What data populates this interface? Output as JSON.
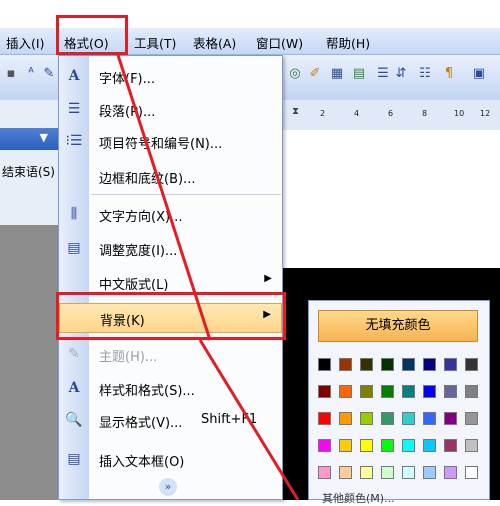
{
  "menubar": {
    "items": [
      {
        "label": "插入(I)"
      },
      {
        "label": "格式(O)"
      },
      {
        "label": "工具(T)"
      },
      {
        "label": "表格(A)"
      },
      {
        "label": "窗口(W)"
      },
      {
        "label": "帮助(H)"
      }
    ]
  },
  "ruler": {
    "ticks": [
      "2",
      "2",
      "4",
      "6",
      "8",
      "10",
      "12",
      "14"
    ]
  },
  "left_pane": {
    "label": "结束语(S)"
  },
  "format_menu": {
    "items": [
      {
        "label": "字体(F)...",
        "icon": "font-icon"
      },
      {
        "label": "段落(P)...",
        "icon": "paragraph-icon"
      },
      {
        "label": "项目符号和编号(N)...",
        "icon": "bullets-icon"
      },
      {
        "label": "边框和底纹(B)...",
        "icon": "borders-icon"
      },
      {
        "label": "文字方向(X)...",
        "icon": "text-direction-icon"
      },
      {
        "label": "调整宽度(I)...",
        "icon": "fit-width-icon"
      },
      {
        "label": "中文版式(L)",
        "icon": "none"
      },
      {
        "label": "背景(K)",
        "icon": "none"
      },
      {
        "label": "主题(H)...",
        "icon": "theme-icon"
      },
      {
        "label": "样式和格式(S)...",
        "icon": "styles-icon"
      },
      {
        "label": "显示格式(V)...",
        "icon": "reveal-format-icon"
      },
      {
        "label": "插入文本框(O)",
        "icon": "textbox-icon"
      }
    ],
    "shortcut_reveal": "Shift+F1"
  },
  "color_submenu": {
    "no_fill_label": "无填充颜色",
    "more_colors_label": "其他颜色(M)...",
    "swatches": [
      [
        "#000000",
        "#993300",
        "#333300",
        "#003300",
        "#003366",
        "#000080",
        "#333399",
        "#333333"
      ],
      [
        "#800000",
        "#FF6600",
        "#808000",
        "#008000",
        "#008080",
        "#0000FF",
        "#666699",
        "#808080"
      ],
      [
        "#FF0000",
        "#FF9900",
        "#99CC00",
        "#339966",
        "#33CCCC",
        "#3366FF",
        "#800080",
        "#969696"
      ],
      [
        "#FF00FF",
        "#FFCC00",
        "#FFFF00",
        "#00FF00",
        "#00FFFF",
        "#00CCFF",
        "#993366",
        "#C0C0C0"
      ],
      [
        "#FF99CC",
        "#FFCC99",
        "#FFFF99",
        "#CCFFCC",
        "#CCFFFF",
        "#99CCFF",
        "#CC99FF",
        "#FFFFFF"
      ]
    ]
  },
  "colors": {
    "annotation_red": "#e41c23",
    "highlight": "#ffd58a"
  }
}
